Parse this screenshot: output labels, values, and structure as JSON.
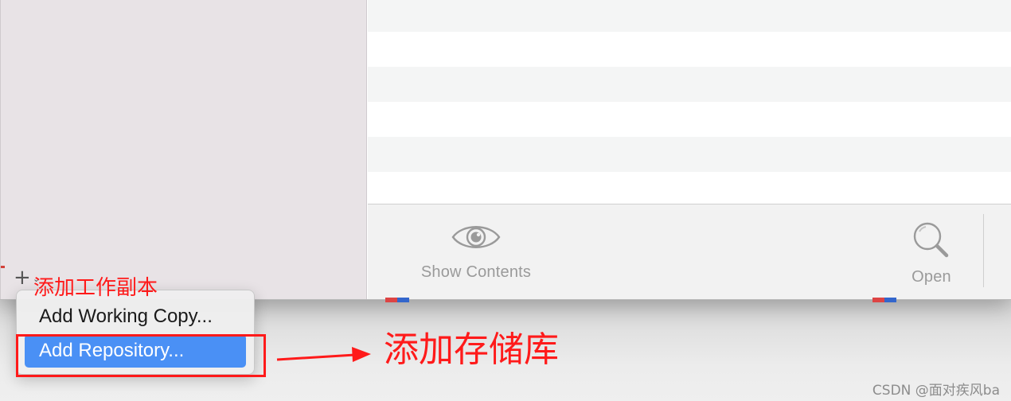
{
  "toolbar": {
    "show_contents_label": "Show Contents",
    "open_label": "Open",
    "show_contents_icon": "eye-icon",
    "open_icon": "magnifier-icon"
  },
  "sidebar": {
    "add_button_icon": "plus-icon",
    "add_menu_chevron_icon": "chevron-down-icon"
  },
  "add_menu": {
    "items": [
      {
        "label": "Add Working Copy..."
      },
      {
        "label": "Add Repository..."
      }
    ],
    "selected_index": 1
  },
  "annotations": {
    "top_label": "添加工作副本",
    "right_label": "添加存储库",
    "color": "#ff1a1a"
  },
  "watermark": "CSDN @面对疾风ba",
  "colors": {
    "menu_selection": "#4a90f5",
    "sidebar_bg": "#e8e3e6"
  }
}
